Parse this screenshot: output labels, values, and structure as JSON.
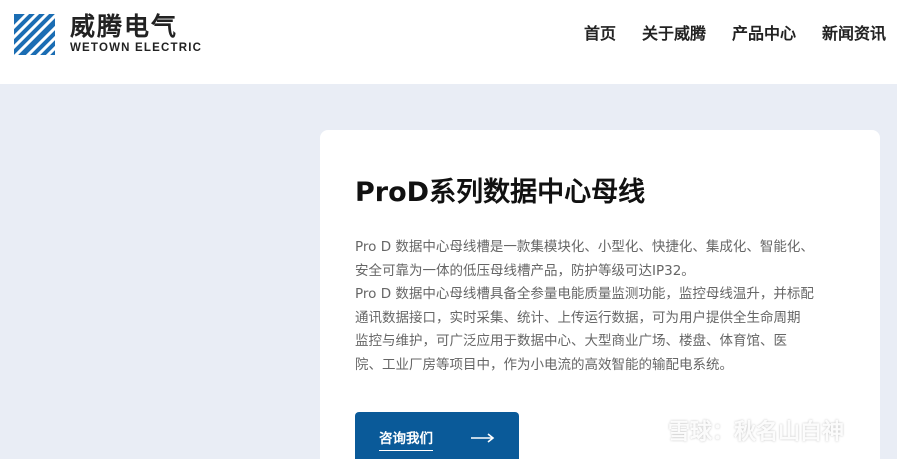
{
  "header": {
    "logo": {
      "name_cn": "威腾电气",
      "name_en": "WETOWN ELECTRIC",
      "mark_icon": "wetown-stripes-logo"
    },
    "nav": [
      {
        "label": "首页"
      },
      {
        "label": "关于威腾"
      },
      {
        "label": "产品中心"
      },
      {
        "label": "新闻资讯"
      }
    ]
  },
  "product": {
    "title": "ProD系列数据中心母线",
    "description": [
      "Pro D 数据中心母线槽是一款集模块化、小型化、快捷化、集成化、智能化、",
      "安全可靠为一体的低压母线槽产品，防护等级可达IP32。",
      "Pro D 数据中心母线槽具备全参量电能质量监测功能，监控母线温升，并标配",
      "通讯数据接口，实时采集、统计、上传运行数据，可为用户提供全生命周期",
      "监控与维护，可广泛应用于数据中心、大型商业广场、楼盘、体育馆、医",
      "院、工业厂房等项目中，作为小电流的高效智能的输配电系统。"
    ],
    "cta": {
      "label": "咨询我们",
      "icon": "arrow-right-icon"
    }
  },
  "watermark": {
    "text": "雪球：秋名山白神",
    "icon": "xueqiu-logo"
  },
  "colors": {
    "brand_blue": "#0a5a99",
    "background": "#e9edf5"
  }
}
